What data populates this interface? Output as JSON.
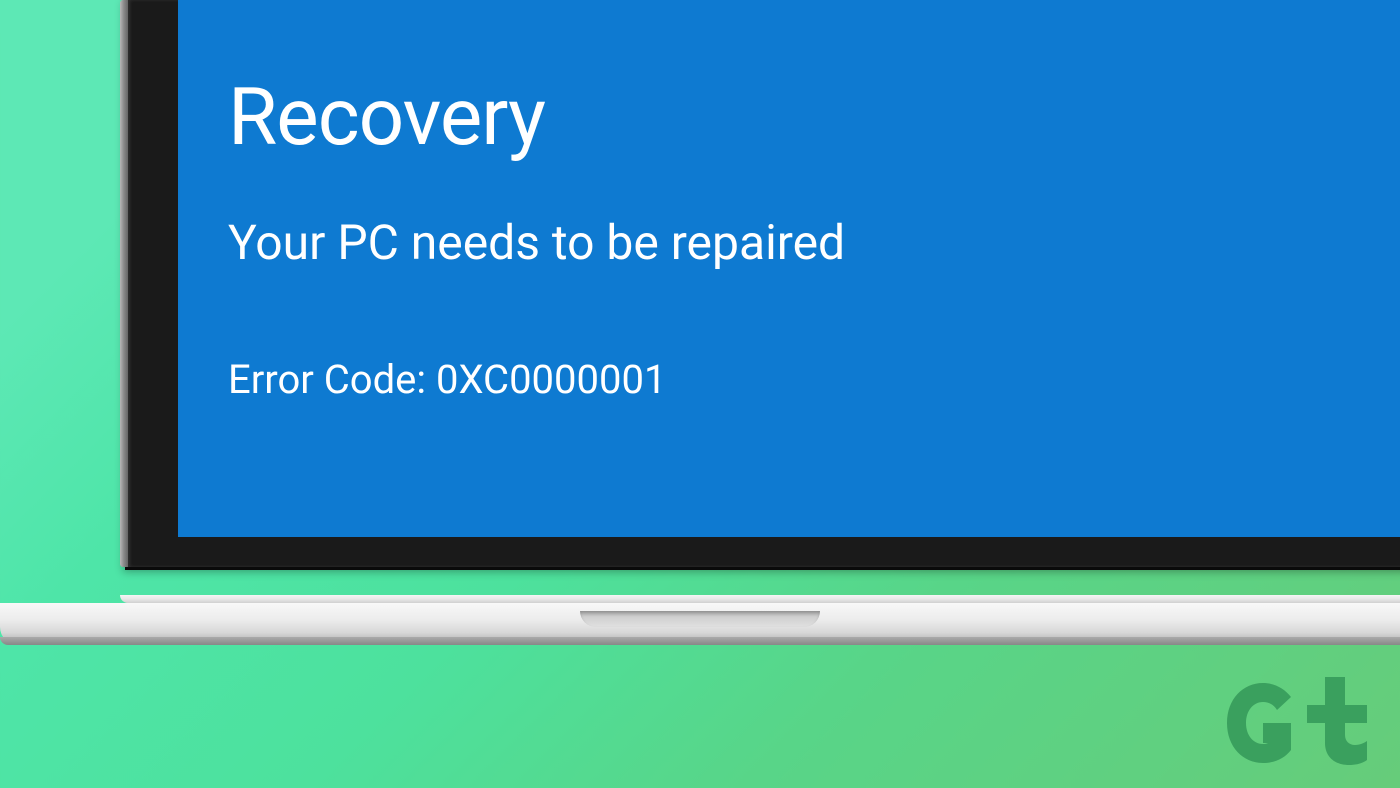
{
  "recovery": {
    "title": "Recovery",
    "subtitle": "Your PC needs to be repaired",
    "error_code": "Error Code: 0XC0000001"
  },
  "colors": {
    "screen_bg": "#0e7ad1",
    "text": "#ffffff",
    "bezel": "#1a1a1a",
    "logo": "#3aa05e"
  }
}
